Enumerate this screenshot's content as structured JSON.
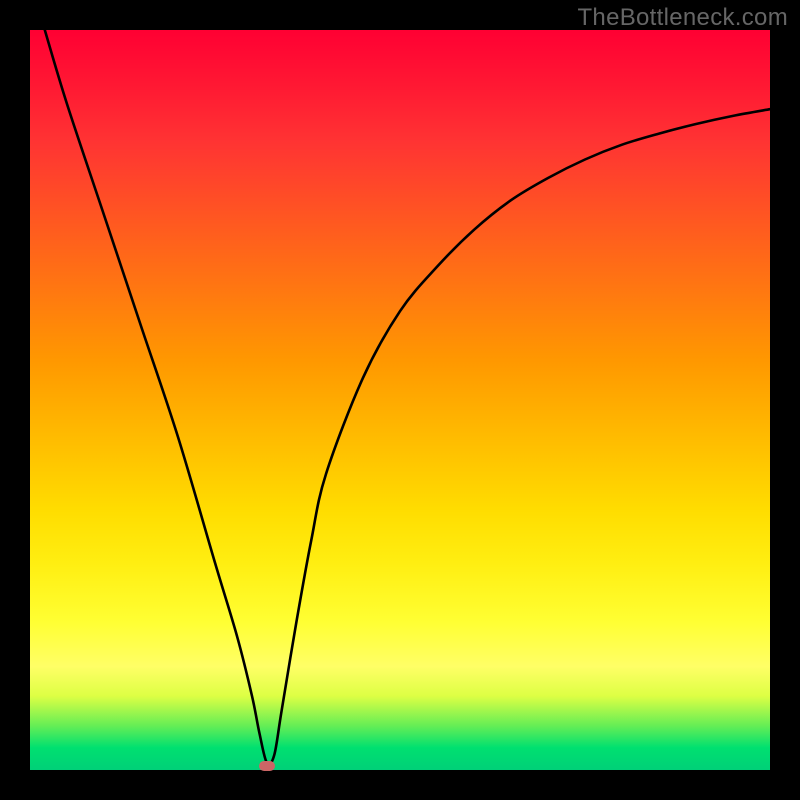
{
  "watermark": "TheBottleneck.com",
  "chart_data": {
    "type": "line",
    "title": "",
    "xlabel": "",
    "ylabel": "",
    "xlim": [
      0,
      100
    ],
    "ylim": [
      0,
      100
    ],
    "grid": false,
    "series": [
      {
        "name": "curve",
        "color": "#000000",
        "x": [
          2,
          5,
          10,
          15,
          20,
          25,
          28,
          30,
          31,
          32,
          33,
          34,
          36,
          38,
          40,
          45,
          50,
          55,
          60,
          65,
          70,
          75,
          80,
          85,
          90,
          95,
          100
        ],
        "y": [
          100,
          90,
          75,
          60,
          45,
          28,
          18,
          10,
          5,
          1,
          2,
          8,
          20,
          31,
          40,
          53,
          62,
          68,
          73,
          77,
          80,
          82.5,
          84.5,
          86,
          87.3,
          88.4,
          89.3
        ]
      }
    ],
    "annotations": [
      {
        "name": "minimum-marker",
        "x": 32,
        "y": 0.5,
        "color": "#cc6666"
      }
    ]
  }
}
